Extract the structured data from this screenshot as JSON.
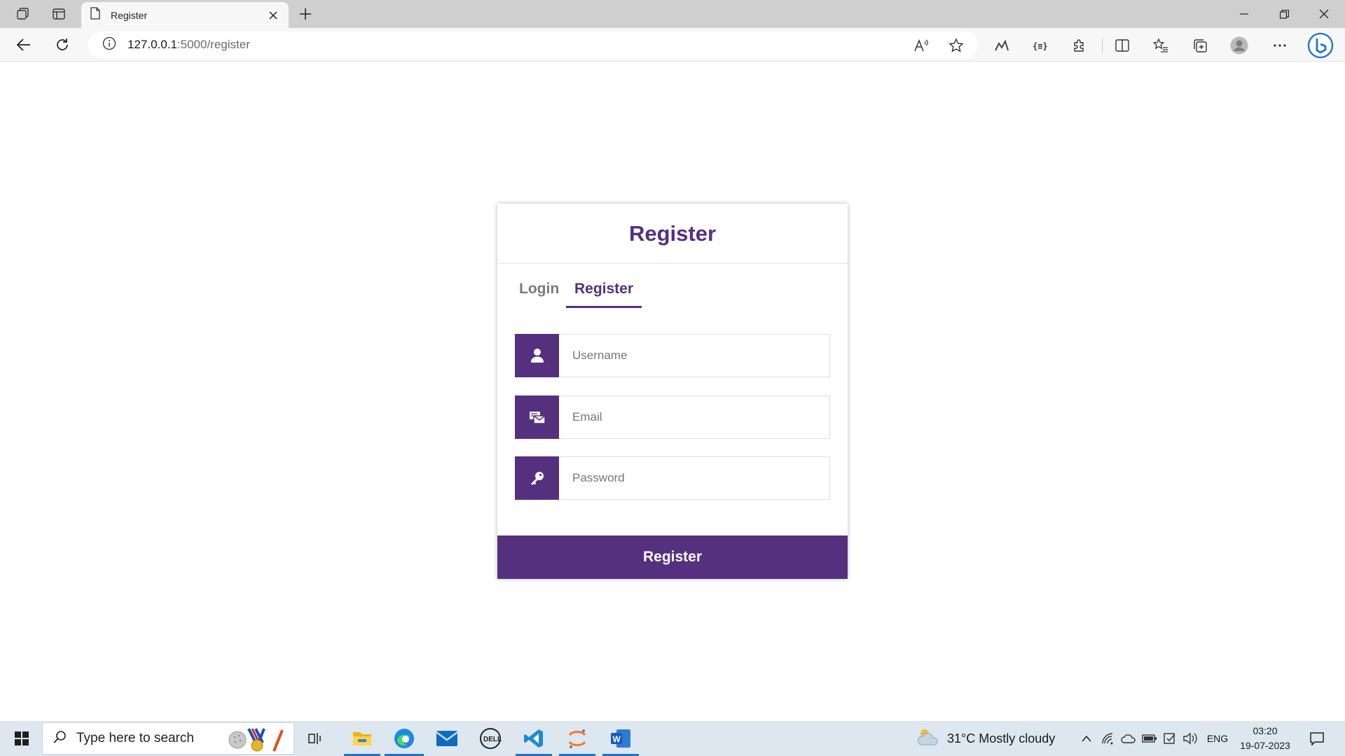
{
  "browser": {
    "tab_title": "Register",
    "url_host": "127.0.0.1",
    "url_path": ":5000/register"
  },
  "page": {
    "card_title": "Register",
    "tabs": [
      {
        "label": "Login",
        "active": false
      },
      {
        "label": "Register",
        "active": true
      }
    ],
    "fields": [
      {
        "placeholder": "Username",
        "icon": "user-icon"
      },
      {
        "placeholder": "Email",
        "icon": "mail-icon"
      },
      {
        "placeholder": "Password",
        "icon": "key-icon"
      }
    ],
    "submit_label": "Register",
    "accent_color": "#55307f"
  },
  "taskbar": {
    "search_placeholder": "Type here to search",
    "weather": "31°C  Mostly cloudy",
    "language": "ENG",
    "time": "03:20",
    "date": "19-07-2023"
  }
}
